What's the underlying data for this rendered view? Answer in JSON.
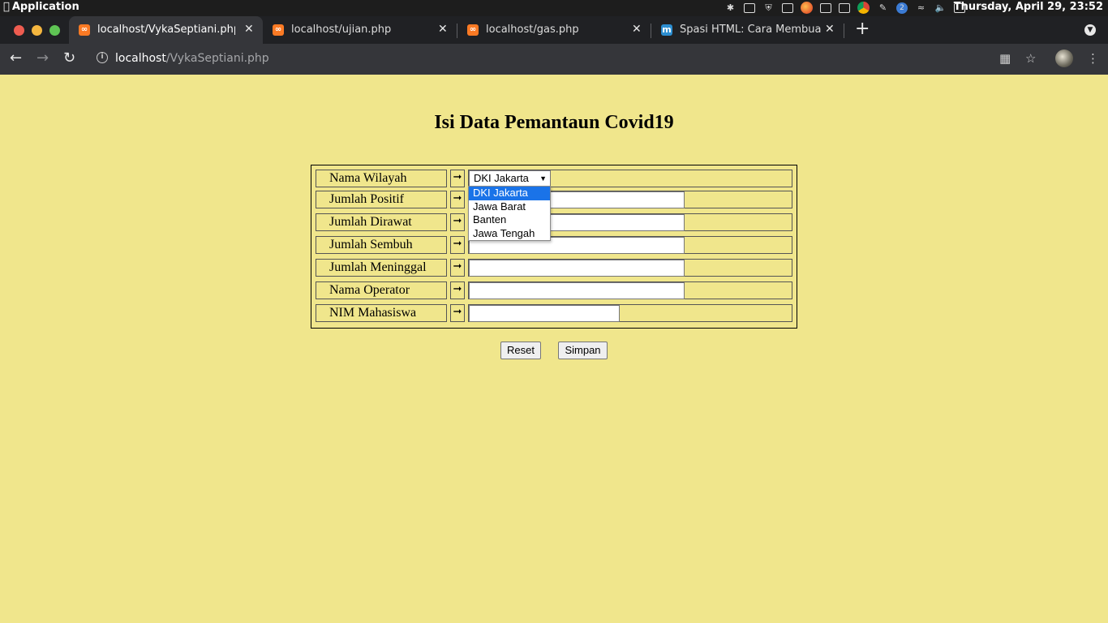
{
  "os": {
    "app_name": "Application",
    "clock": "Thursday, April 29, 23:52",
    "tray_badge": "2"
  },
  "browser": {
    "tabs": [
      {
        "title": "localhost/VykaSeptiani.php",
        "active": true
      },
      {
        "title": "localhost/ujian.php",
        "active": false
      },
      {
        "title": "localhost/gas.php",
        "active": false
      },
      {
        "title": "Spasi HTML: Cara Membuat Sp",
        "active": false
      }
    ],
    "url_host": "localhost",
    "url_path": "/VykaSeptiani.php"
  },
  "page": {
    "heading": "Isi Data Pemantaun Covid19",
    "arrow_glyph": "➞",
    "fields": [
      {
        "label": "Nama Wilayah",
        "type": "select",
        "value": "DKI Jakarta"
      },
      {
        "label": "Jumlah Positif",
        "type": "text",
        "value": ""
      },
      {
        "label": "Jumlah Dirawat",
        "type": "text",
        "value": ""
      },
      {
        "label": "Jumlah Sembuh",
        "type": "text",
        "value": ""
      },
      {
        "label": "Jumlah Meninggal",
        "type": "text",
        "value": ""
      },
      {
        "label": "Nama Operator",
        "type": "text",
        "value": ""
      },
      {
        "label": "NIM Mahasiswa",
        "type": "text",
        "value": ""
      }
    ],
    "wilayah_options": [
      "DKI Jakarta",
      "Jawa Barat",
      "Banten",
      "Jawa Tengah"
    ],
    "reset_label": "Reset",
    "submit_label": "Simpan"
  },
  "colors": {
    "page_background": "#f0e68c",
    "highlight": "#1a73e8"
  }
}
